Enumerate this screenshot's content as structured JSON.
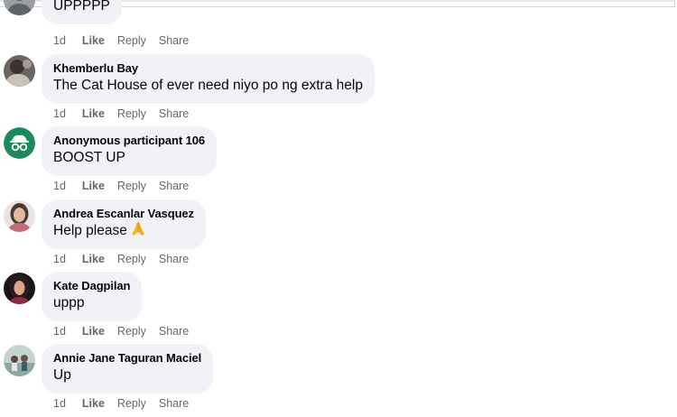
{
  "colors": {
    "bubble": "#f0f2f5",
    "author": "#050505",
    "meta": "#65676b",
    "anon_avatar": "#1c8a5c"
  },
  "comments": [
    {
      "author": "",
      "text": "UPPPPP",
      "time": "1d",
      "like": "Like",
      "reply": "Reply",
      "share": "Share",
      "avatar_icon": "user-photo-avatar"
    },
    {
      "author": "Khemberlu Bay",
      "text": "The Cat House of ever need niyo po ng extra help",
      "time": "1d",
      "like": "Like",
      "reply": "Reply",
      "share": "Share",
      "avatar_icon": "user-photo-avatar"
    },
    {
      "author": "Anonymous participant 106",
      "text": "BOOST UP",
      "time": "1d",
      "like": "Like",
      "reply": "Reply",
      "share": "Share",
      "avatar_icon": "anonymous-incognito-icon"
    },
    {
      "author": "Andrea Escanlar Vasquez",
      "text": "Help please",
      "emoji": "folded-hands-emoji",
      "time": "1d",
      "like": "Like",
      "reply": "Reply",
      "share": "Share",
      "avatar_icon": "user-photo-avatar"
    },
    {
      "author": "Kate Dagpilan",
      "text": "uppp",
      "time": "1d",
      "like": "Like",
      "reply": "Reply",
      "share": "Share",
      "avatar_icon": "user-photo-avatar"
    },
    {
      "author": "Annie Jane Taguran Maciel",
      "text": "Up",
      "time": "1d",
      "like": "Like",
      "reply": "Reply",
      "share": "Share",
      "avatar_icon": "user-photo-avatar"
    }
  ]
}
